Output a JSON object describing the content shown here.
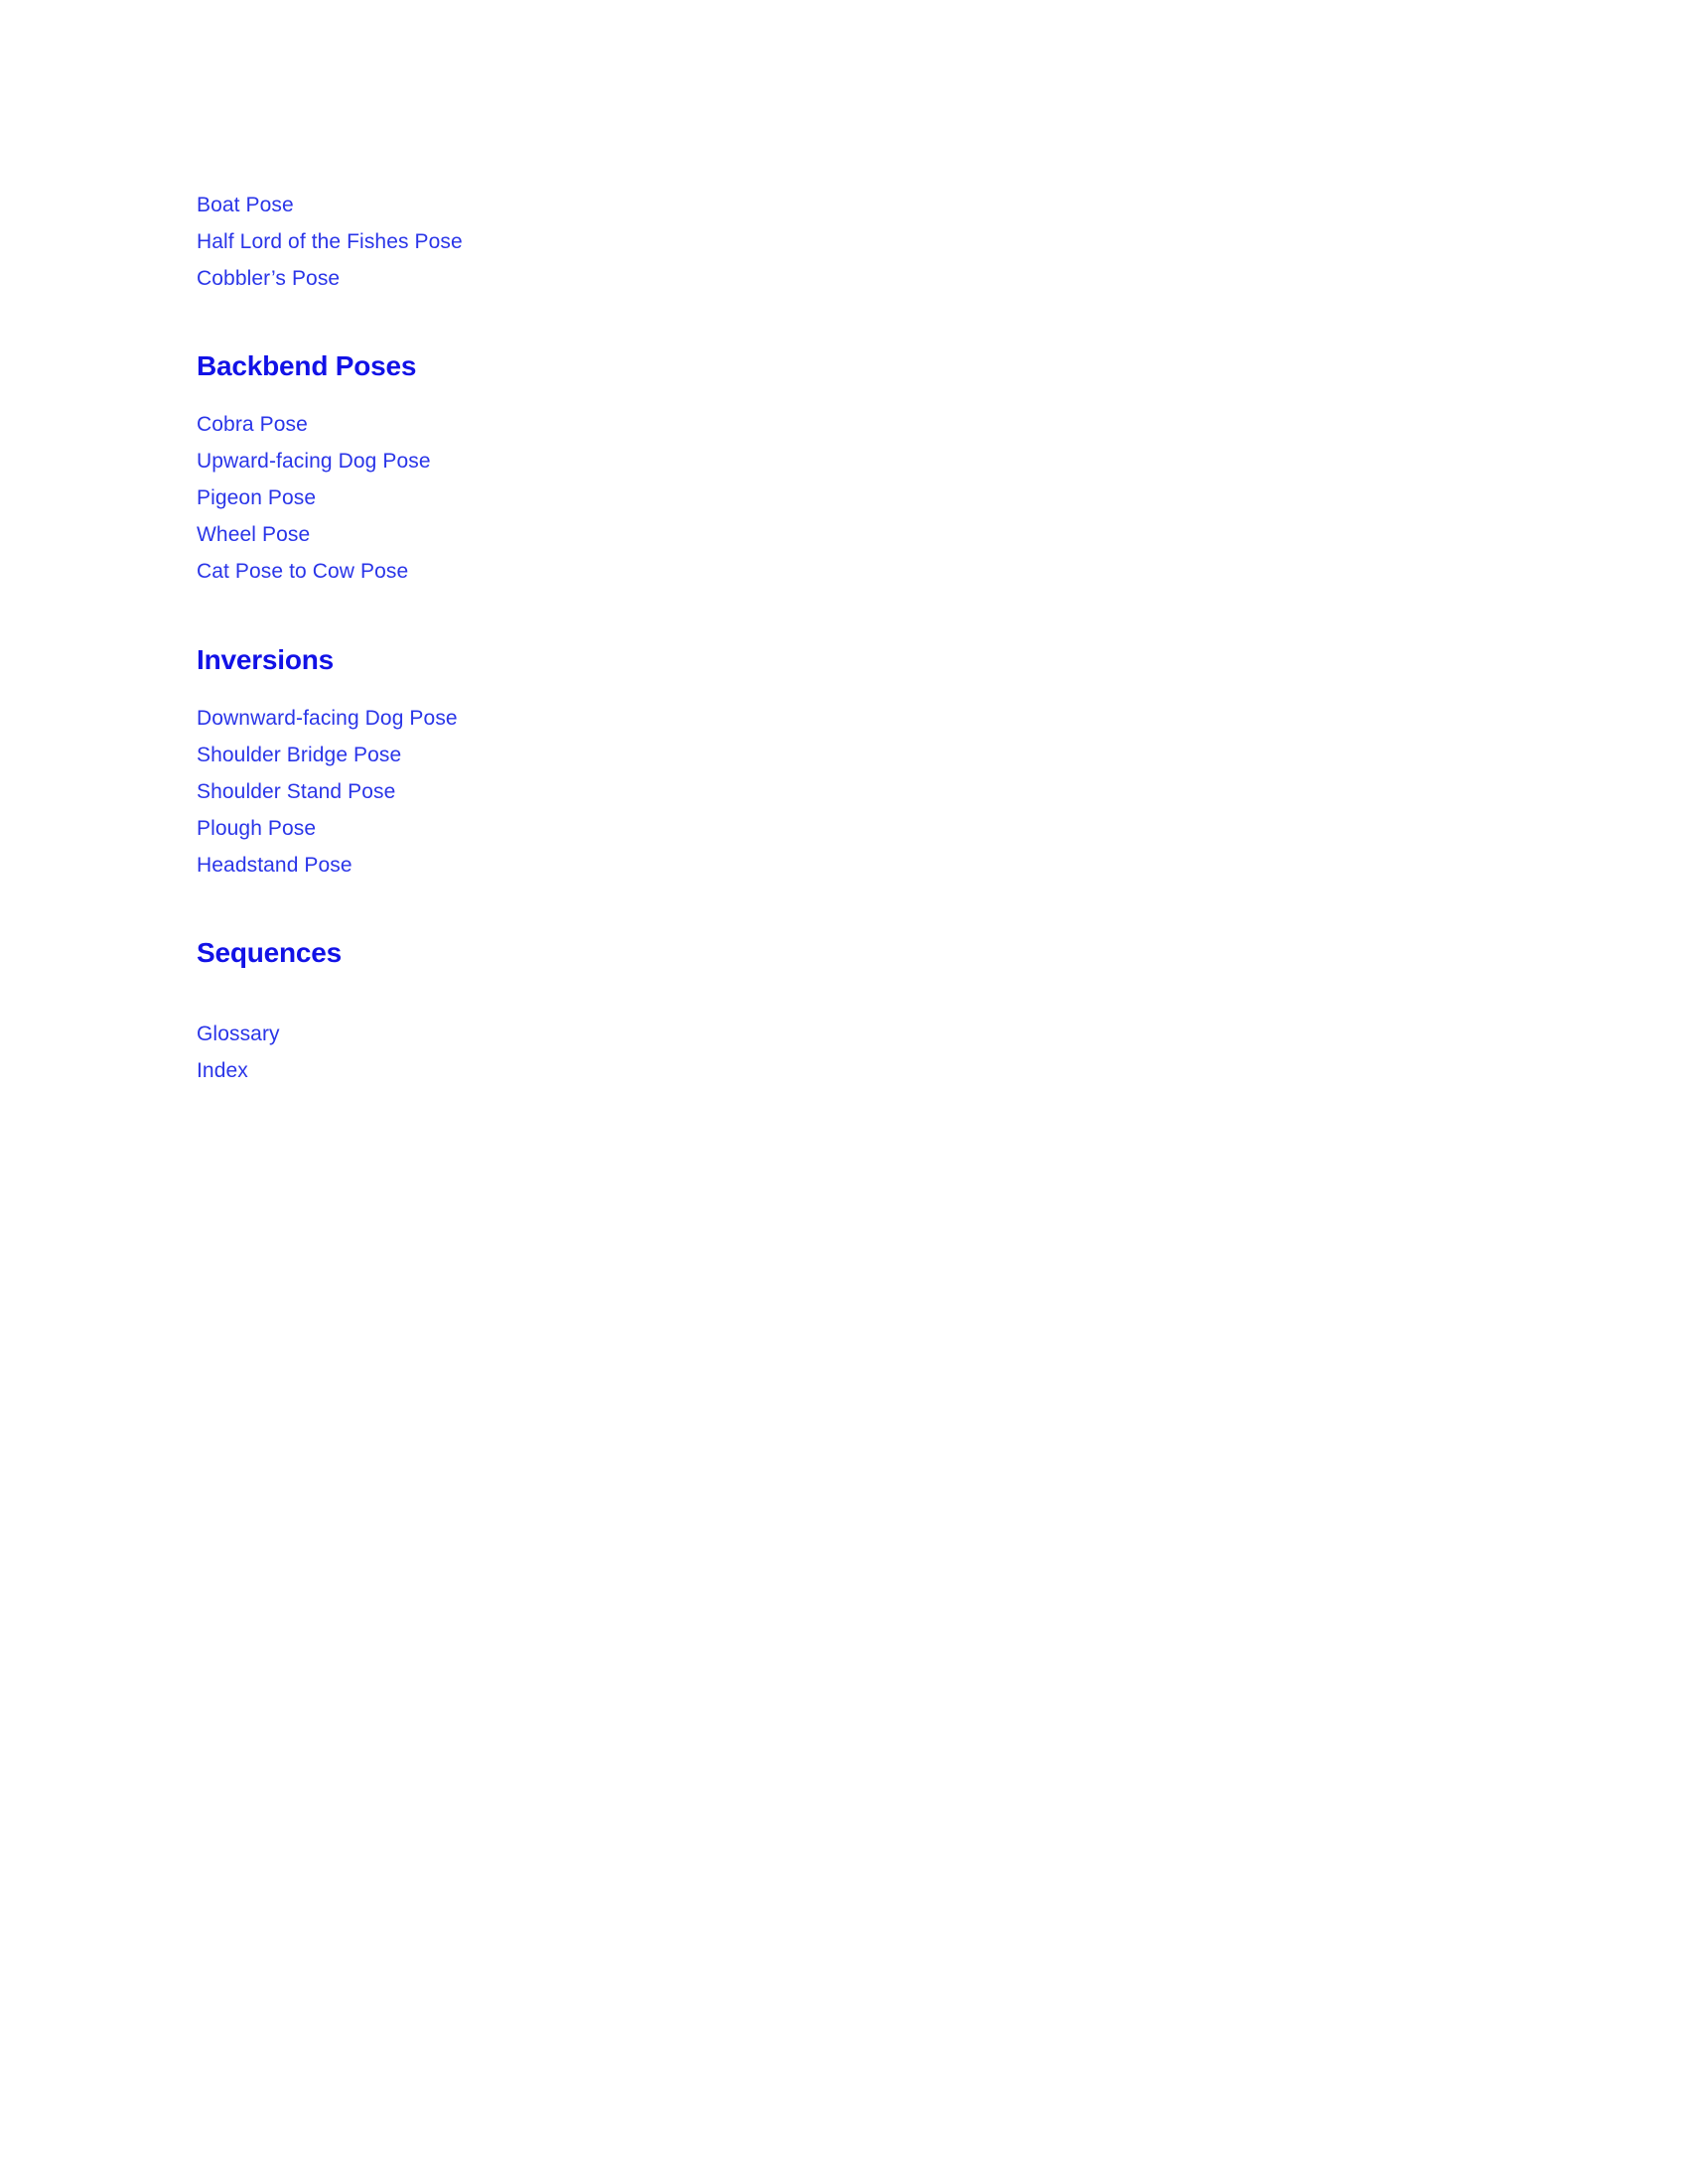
{
  "document": {
    "type": "table-of-contents",
    "background_color": "#ffffff",
    "link_color": "#2a35e8",
    "heading_color": "#1212e6",
    "groups": [
      {
        "heading": null,
        "entries": [
          "Boat Pose",
          "Half Lord of the Fishes Pose",
          "Cobbler’s Pose"
        ]
      },
      {
        "heading": "Backbend Poses",
        "entries": [
          "Cobra Pose",
          "Upward-facing Dog Pose",
          "Pigeon Pose",
          "Wheel Pose",
          "Cat Pose to Cow Pose"
        ]
      },
      {
        "heading": "Inversions",
        "entries": [
          "Downward-facing Dog Pose",
          "Shoulder Bridge Pose",
          "Shoulder Stand Pose",
          "Plough Pose",
          "Headstand Pose"
        ]
      },
      {
        "heading": "Sequences",
        "entries": []
      },
      {
        "heading": null,
        "entries": [
          "Glossary",
          "Index"
        ]
      }
    ]
  }
}
